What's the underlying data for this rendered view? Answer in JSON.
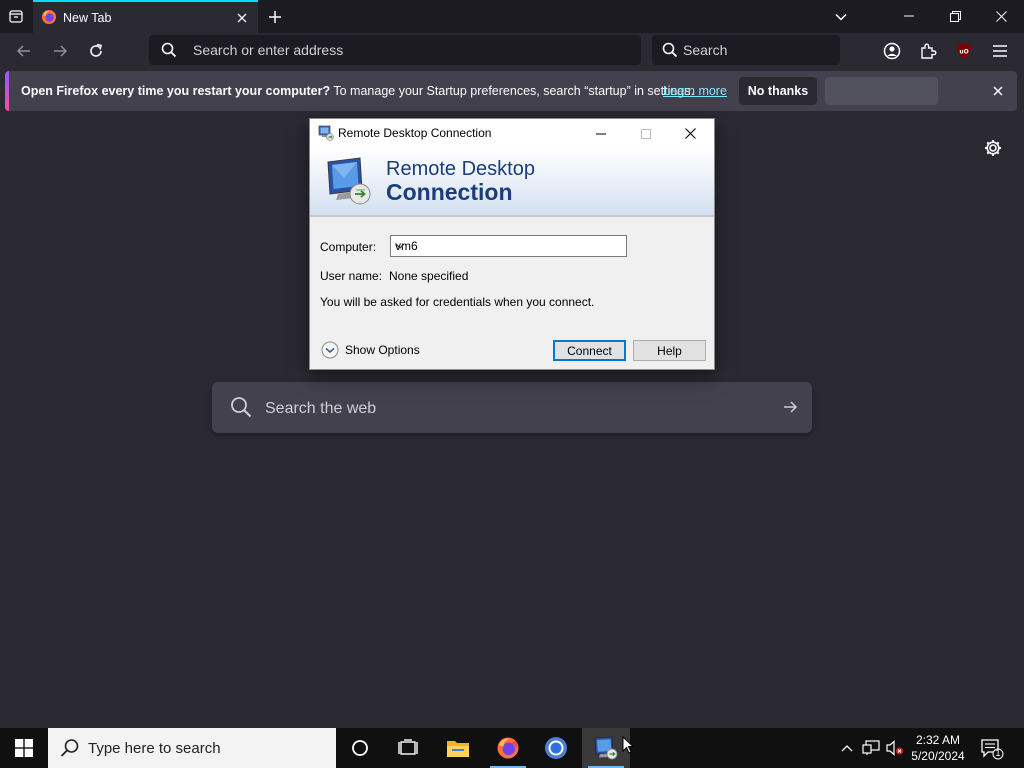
{
  "browser": {
    "tab_title": "New Tab",
    "address_placeholder": "Search or enter address",
    "search_placeholder": "Search"
  },
  "notification": {
    "bold_text": "Open Firefox every time you restart your computer?",
    "message": " To manage your Startup preferences, search “startup” in settings.",
    "learn_more": "Learn more",
    "no_thanks": "No thanks",
    "accent_gradient": [
      "#9059ff",
      "#ff4aa2"
    ]
  },
  "newtab": {
    "search_placeholder": "Search the web"
  },
  "rdc_dialog": {
    "title": "Remote Desktop Connection",
    "banner_line1": "Remote Desktop",
    "banner_line2": "Connection",
    "computer_label": "Computer:",
    "computer_value": "vm6",
    "username_label": "User name:",
    "username_value": "None specified",
    "credentials_note": "You will be asked for credentials when you connect.",
    "show_options": "Show Options",
    "connect": "Connect",
    "help": "Help"
  },
  "taskbar": {
    "search_placeholder": "Type here to search",
    "time": "2:32 AM",
    "date": "5/20/2024",
    "notification_count": "1",
    "pinned": [
      "cortana-icon",
      "task-view-icon",
      "file-explorer-icon",
      "firefox-icon",
      "chrome-icon",
      "remote-desktop-icon"
    ]
  },
  "colors": {
    "page_bg": "#2b2a33",
    "toolbar_dark": "#1c1b22",
    "link": "#80ebff",
    "rdc_banner_text": "#1a3e7a"
  }
}
